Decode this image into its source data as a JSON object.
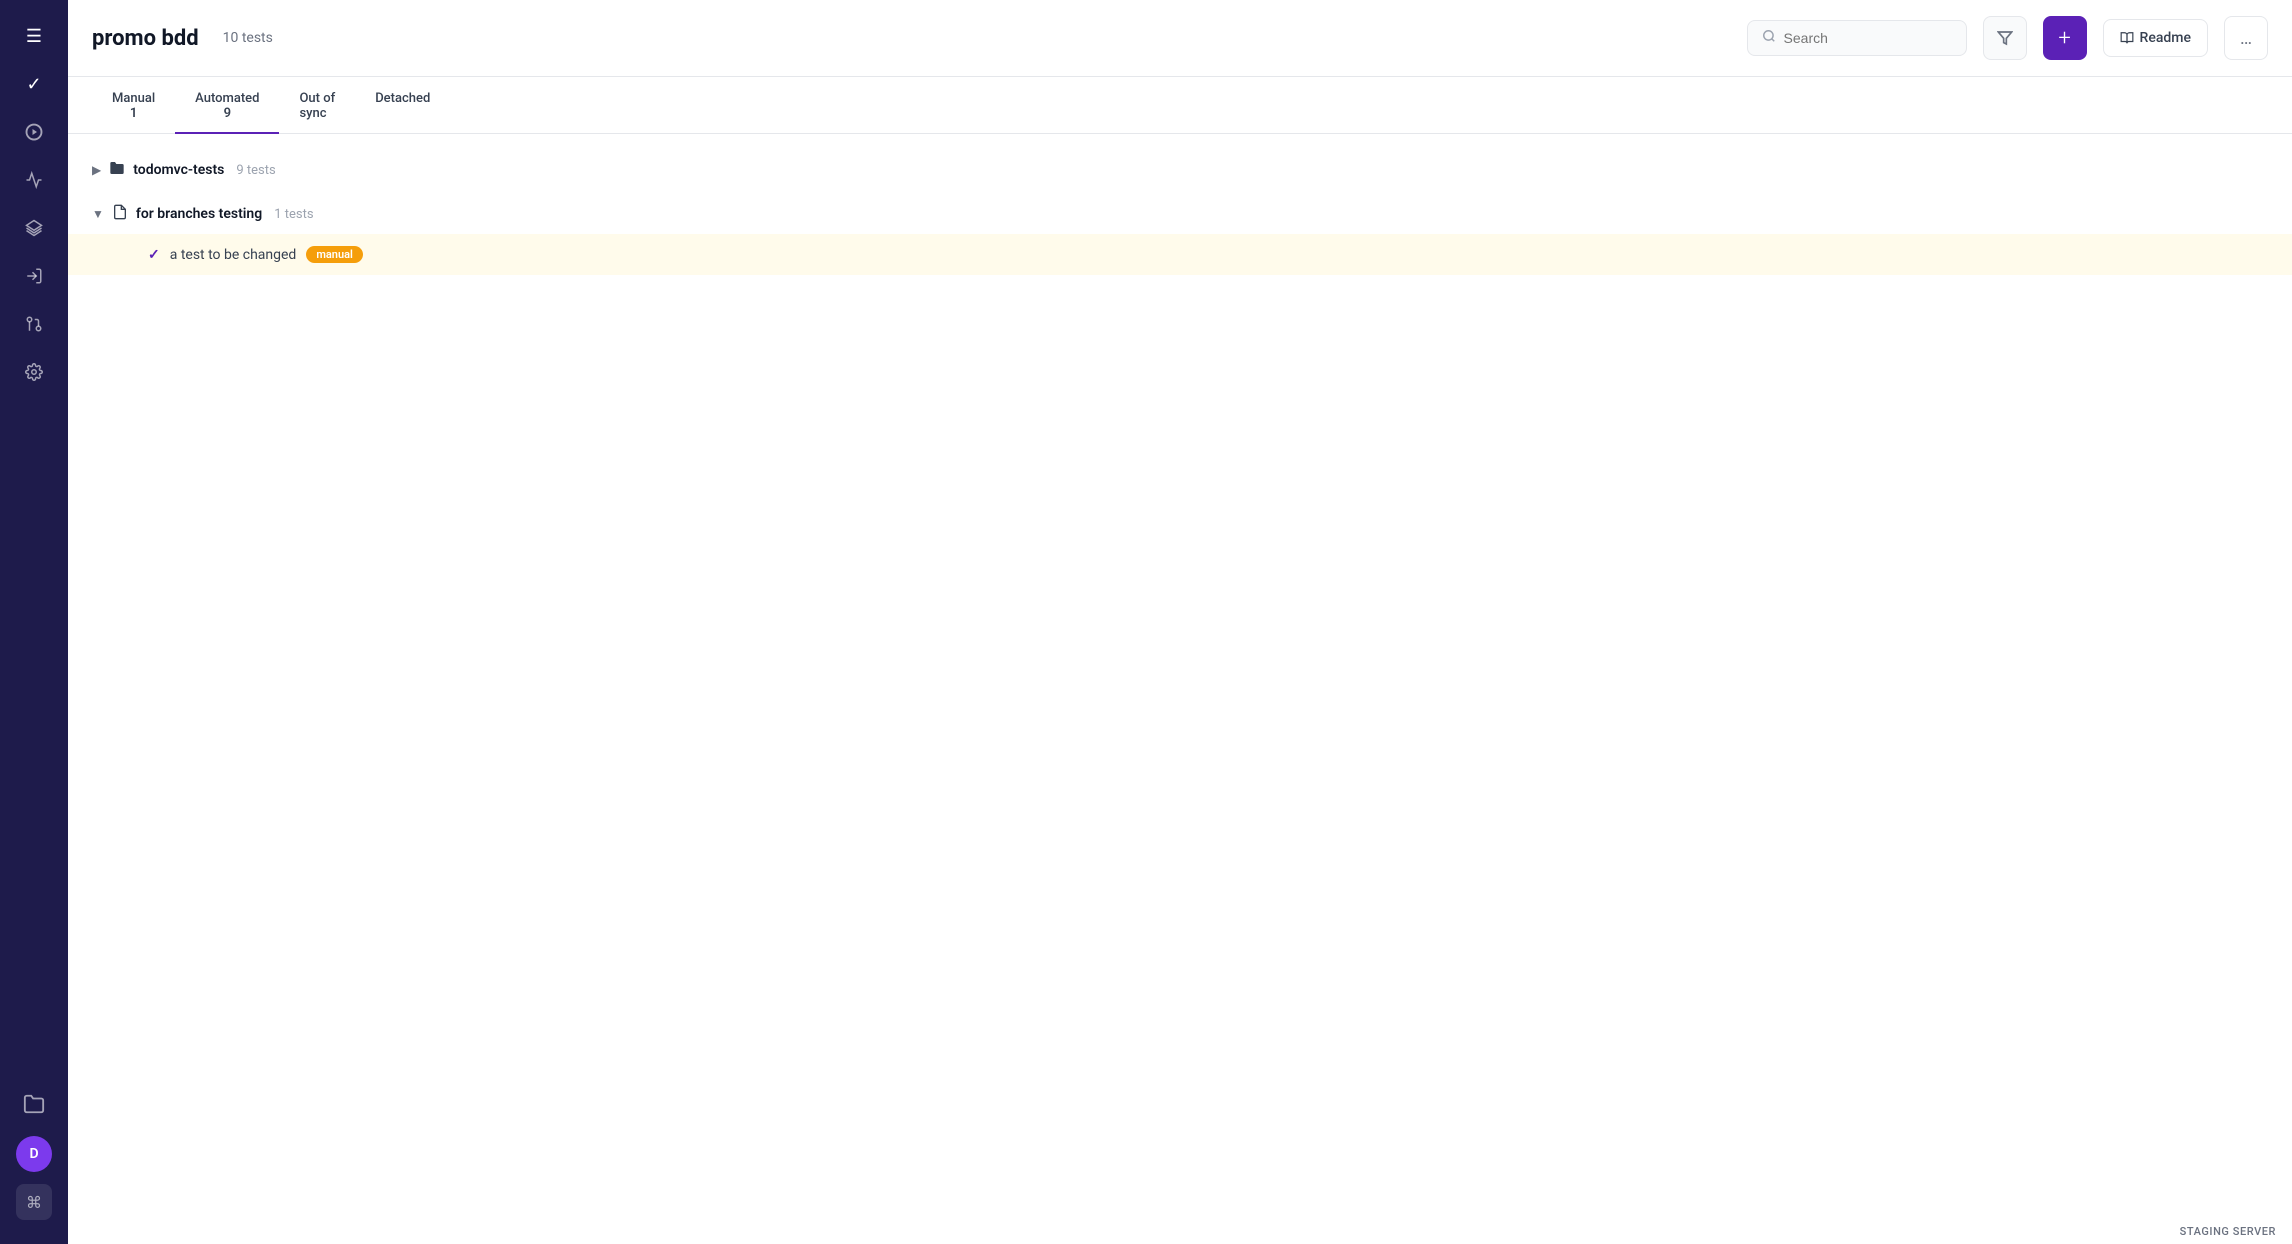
{
  "sidebar": {
    "icons": [
      {
        "name": "menu-icon",
        "symbol": "☰"
      },
      {
        "name": "check-icon",
        "symbol": "✓"
      },
      {
        "name": "play-icon",
        "symbol": "▶"
      },
      {
        "name": "list-check-icon",
        "symbol": "≡"
      },
      {
        "name": "layers-icon",
        "symbol": "⬡"
      },
      {
        "name": "login-icon",
        "symbol": "⊞"
      },
      {
        "name": "git-icon",
        "symbol": "⌥"
      },
      {
        "name": "settings-icon",
        "symbol": "⚙"
      }
    ],
    "folders_icon": "🗂",
    "avatar_label": "D",
    "keyboard_symbol": "⌘"
  },
  "header": {
    "title": "promo bdd",
    "test_count": "10 tests",
    "search_placeholder": "Search",
    "filter_label": "▼",
    "add_label": "+",
    "readme_label": "Readme",
    "more_label": "…"
  },
  "tabs": [
    {
      "label": "Manual",
      "count": "1"
    },
    {
      "label": "Automated",
      "count": "9"
    },
    {
      "label": "Out of sync",
      "count": ""
    },
    {
      "label": "Detached",
      "count": ""
    }
  ],
  "groups": [
    {
      "name": "todomvc-tests",
      "count": "9 tests",
      "type": "folder",
      "expanded": false,
      "items": []
    },
    {
      "name": "for branches testing",
      "count": "1 tests",
      "type": "doc",
      "expanded": true,
      "items": [
        {
          "name": "a test to be changed",
          "badge": "manual"
        }
      ]
    }
  ],
  "status": {
    "label": "STAGING SERVER"
  }
}
